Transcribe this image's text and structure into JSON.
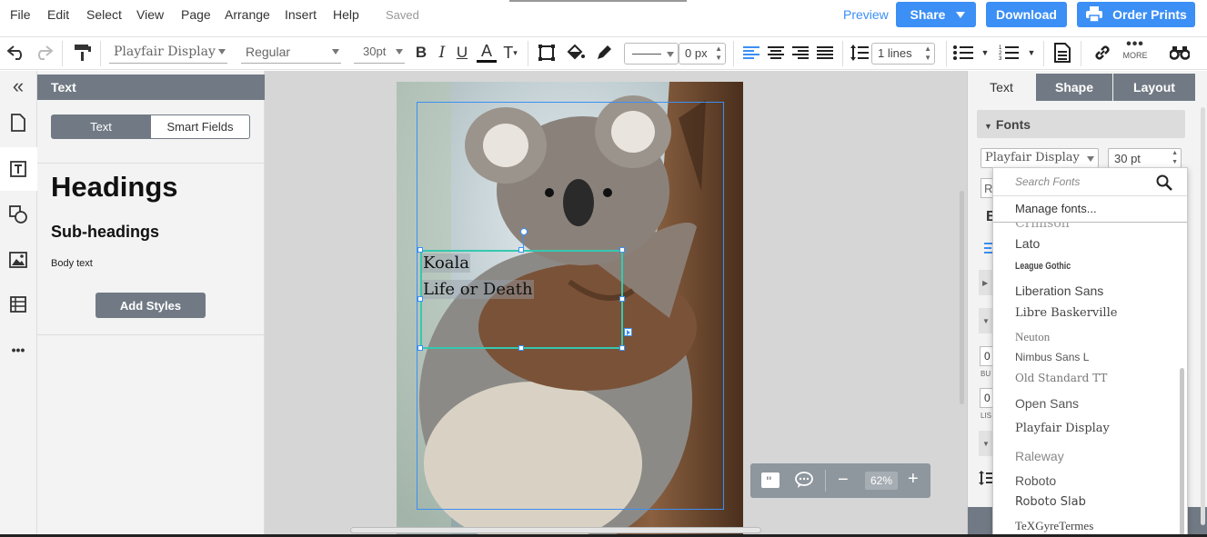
{
  "menu": {
    "items": [
      "File",
      "Edit",
      "Select",
      "View",
      "Page",
      "Arrange",
      "Insert",
      "Help"
    ],
    "status": "Saved",
    "preview": "Preview",
    "share": "Share",
    "download": "Download",
    "order_prints": "Order Prints"
  },
  "toolbar": {
    "font_family": "Playfair Display",
    "font_weight": "Regular",
    "font_size": "30pt",
    "bold": "B",
    "italic": "I",
    "underline": "U",
    "text_color": "A",
    "text_size": "T",
    "border_width": "0 px",
    "line_spacing": "1 lines",
    "more_label": "MORE"
  },
  "left_panel": {
    "title": "Text",
    "tab_text": "Text",
    "tab_smart": "Smart Fields",
    "heading": "Headings",
    "subheading": "Sub-headings",
    "body": "Body text",
    "add_styles": "Add Styles"
  },
  "canvas": {
    "line1": "Koala",
    "line2": "Life or Death",
    "zoom": "62%"
  },
  "right_panel": {
    "tabs": [
      "Text",
      "Shape",
      "Layout"
    ],
    "section_fonts": "Fonts",
    "font_family": "Playfair Display",
    "font_size": "30 pt",
    "partial_labels": [
      "R",
      "B",
      "BU",
      "LIS",
      "0",
      "0"
    ]
  },
  "font_dropdown": {
    "search_placeholder": "Search Fonts",
    "manage": "Manage fonts...",
    "partial_top": "Crimson",
    "fonts": [
      "Lato",
      "League Gothic",
      "Liberation Sans",
      "Libre Baskerville",
      "Neuton",
      "Nimbus Sans L",
      "Old Standard TT",
      "Open Sans",
      "Playfair Display",
      "Raleway",
      "Roboto",
      "Roboto Slab",
      "TeXGyreTermes"
    ]
  },
  "colors": {
    "accent": "#3b8ff5",
    "panel_header": "#717a84",
    "selection": "#35c9b0"
  }
}
